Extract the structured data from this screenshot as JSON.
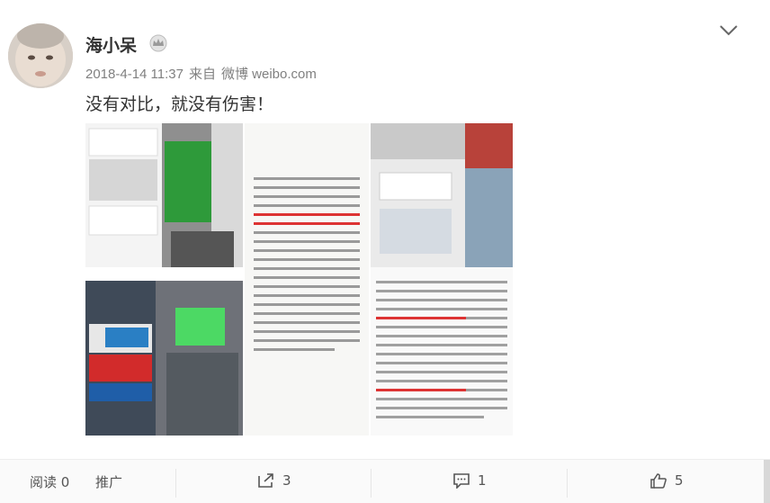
{
  "post": {
    "author": "海小呆",
    "date": "2018-4-14 11:37",
    "via_label": "来自",
    "source": "微博 weibo.com",
    "text": "没有对比，就没有伤害！"
  },
  "icons": {
    "avatar": "avatar",
    "badge": "crown-badge-icon",
    "menu": "chevron-down-icon",
    "share": "share-icon",
    "comment": "comment-icon",
    "like": "thumbs-up-icon"
  },
  "actions": {
    "read_label": "阅读",
    "read_count": "0",
    "promote_label": "推广",
    "share_count": "3",
    "comment_count": "1",
    "like_count": "5"
  },
  "colors": {
    "text": "#333333",
    "meta": "#808080",
    "action_bar": "#fafafa",
    "green_sign": "#2e9a3a"
  }
}
